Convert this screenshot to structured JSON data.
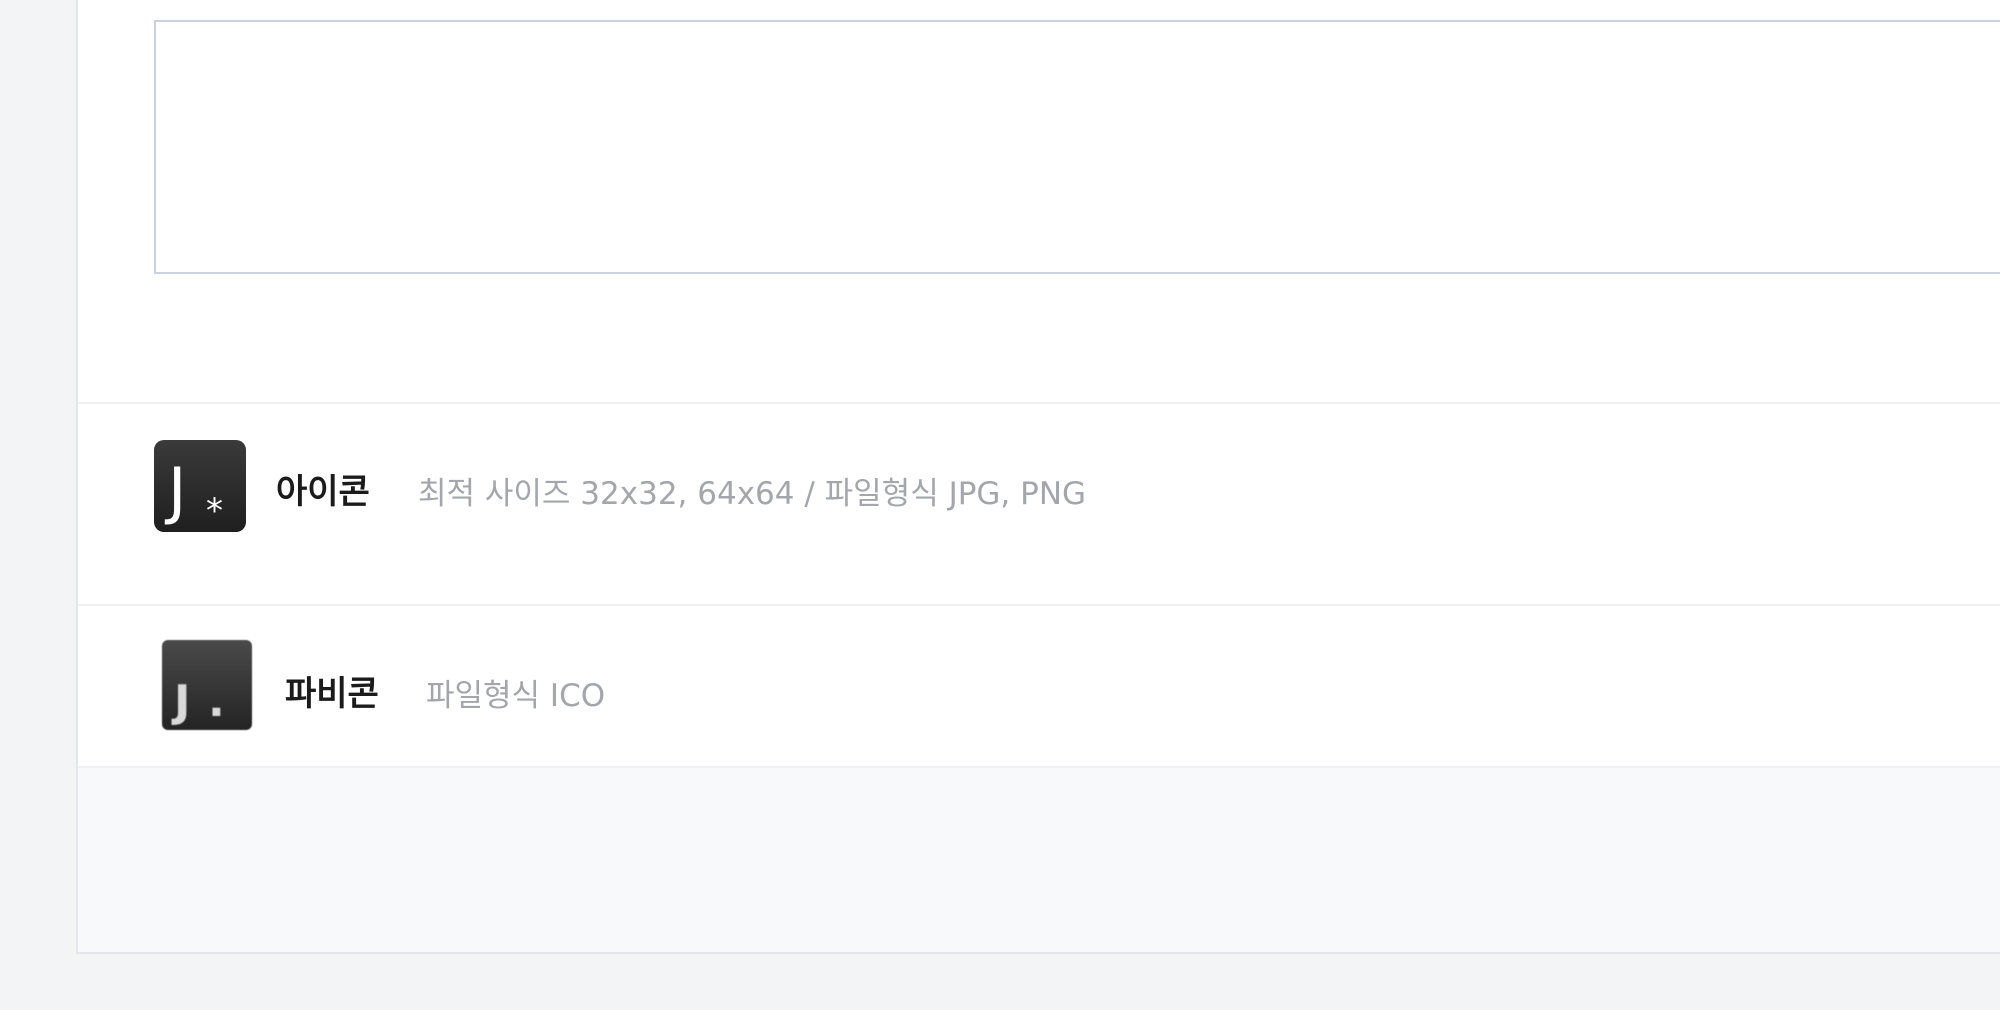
{
  "settings": {
    "icon": {
      "title": "아이콘",
      "description": "최적 사이즈 32x32, 64x64 / 파일형식 JPG, PNG",
      "image_glyph": "J",
      "image_mark": "*",
      "icon_name": "app-icon-j-asterisk"
    },
    "favicon": {
      "title": "파비콘",
      "description": "파일형식 ICO",
      "image_glyph": "J",
      "image_mark": ".",
      "icon_name": "favicon-j-dot"
    }
  },
  "colors": {
    "page_background": "#f3f4f6",
    "panel_background": "#ffffff",
    "input_border": "#c9d2e0",
    "divider": "#eef0f3",
    "title_text": "#1b1b1b",
    "description_text": "#a3a6ab",
    "icon_background": "#1f1f1f"
  }
}
